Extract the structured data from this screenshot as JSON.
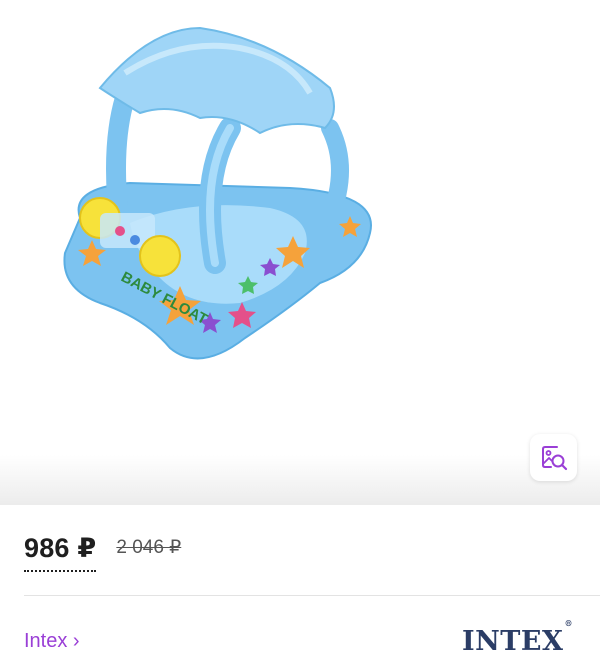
{
  "product": {
    "price_current": "986 ₽",
    "price_old": "2 046 ₽",
    "brand_link": "Intex ›",
    "brand_logo_text": "INTEX",
    "trademark": "®",
    "float_text": "BABY FLOAT"
  },
  "icons": {
    "visual_search": "image-search-icon"
  },
  "colors": {
    "accent": "#9a3fd6",
    "brand_logo": "#2b3d66",
    "float_blue": "#7cc3f0"
  }
}
